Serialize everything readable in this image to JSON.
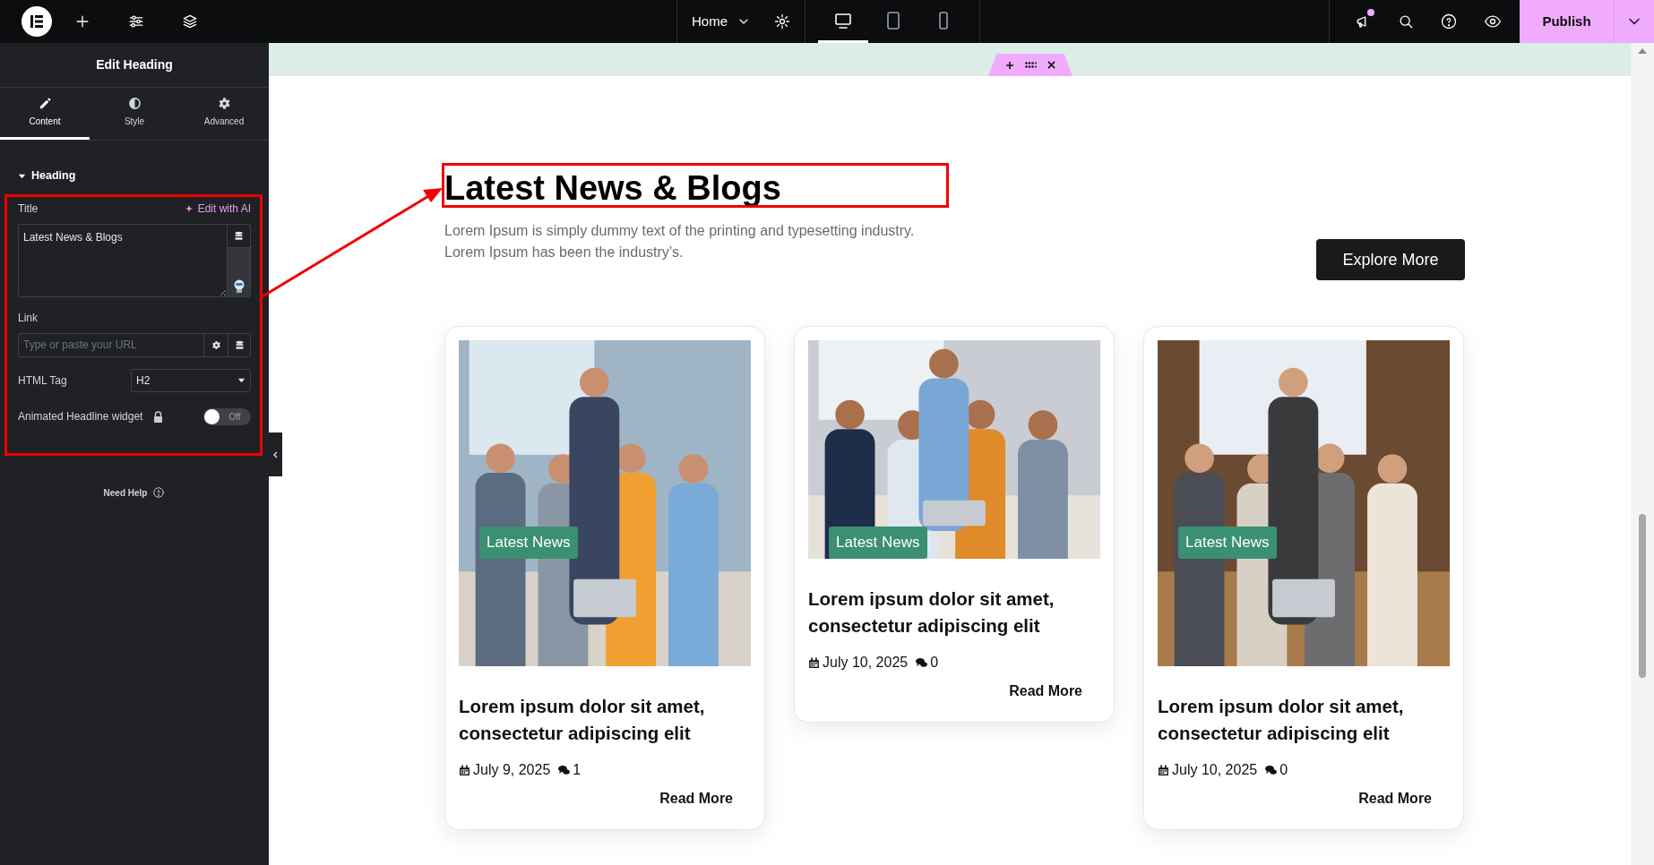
{
  "top_bar": {
    "home_menu": "Home",
    "devices": [
      {
        "kind": "desktop",
        "selected": true
      },
      {
        "kind": "tablet",
        "selected": false
      },
      {
        "kind": "mobile",
        "selected": false
      }
    ],
    "has_notification": true,
    "publish": "Publish"
  },
  "panel": {
    "title": "Edit Heading",
    "tabs": [
      {
        "kind": "content",
        "label": "Content",
        "selected": true
      },
      {
        "kind": "style",
        "label": "Style",
        "selected": false
      },
      {
        "kind": "advanced",
        "label": "Advanced",
        "selected": false
      }
    ],
    "section": {
      "title": "Heading",
      "expanded": true
    },
    "title_label": "Title",
    "ai_link": "Edit with AI",
    "title_value": "Latest News & Blogs",
    "link_label": "Link",
    "link_placeholder": "Type or paste your URL",
    "html_tag_label": "HTML Tag",
    "html_tag_value": "H2",
    "animated_label": "Animated Headline widget",
    "animated_toggle": {
      "on": false,
      "label": "Off"
    },
    "need_help": "Need Help"
  },
  "canvas": {
    "heading": "Latest News & Blogs",
    "description": "Lorem Ipsum is simply dummy text of the printing and typesetting industry. Lorem Ipsum has been the industry’s.",
    "button": "Explore More",
    "cards": [
      {
        "tag": "Latest News",
        "title": "Lorem ipsum dolor sit amet, consectetur adipiscing elit",
        "date": "July 9, 2025",
        "comments": "1",
        "read_more": "Read More"
      },
      {
        "tag": "Latest News",
        "title": "Lorem ipsum dolor sit amet, consectetur adipiscing elit",
        "date": "July 10, 2025",
        "comments": "0",
        "read_more": "Read More"
      },
      {
        "tag": "Latest News",
        "title": "Lorem ipsum dolor sit amet, consectetur adipiscing elit",
        "date": "July 10, 2025",
        "comments": "0",
        "read_more": "Read More"
      }
    ]
  }
}
